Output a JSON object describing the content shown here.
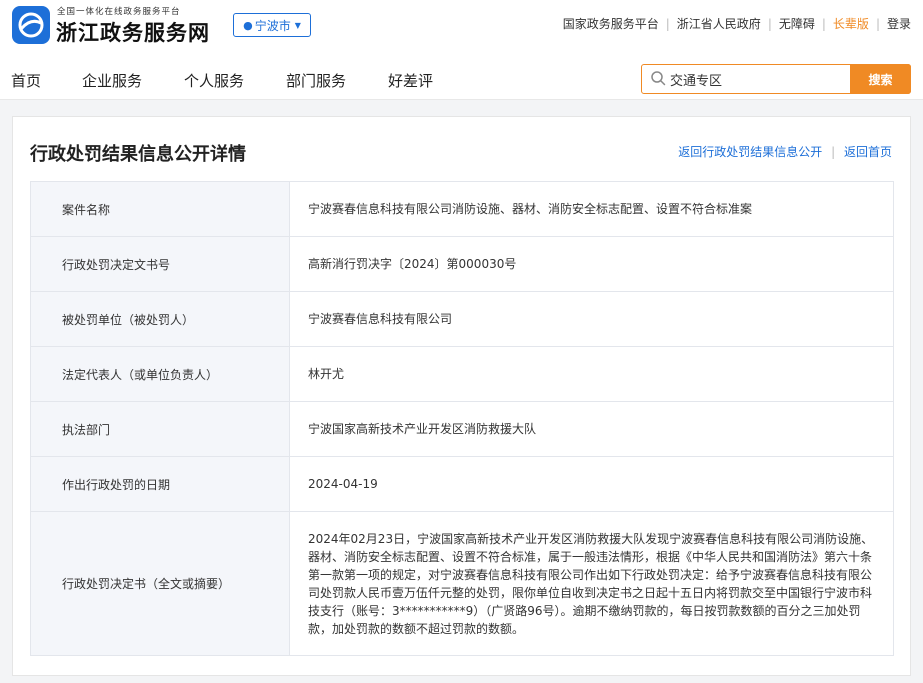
{
  "header": {
    "logo_subtitle": "全国一体化在线政务服务平台",
    "logo_title": "浙江政务服务网",
    "city": "宁波市",
    "links": [
      "国家政务服务平台",
      "浙江省人民政府",
      "无障碍",
      "长辈版",
      "登录"
    ]
  },
  "nav": {
    "items": [
      "首页",
      "企业服务",
      "个人服务",
      "部门服务",
      "好差评"
    ]
  },
  "search": {
    "value": "交通专区",
    "button": "搜索"
  },
  "page": {
    "title": "行政处罚结果信息公开详情",
    "back_link": "返回行政处罚结果信息公开",
    "home_link": "返回首页"
  },
  "details": [
    {
      "label": "案件名称",
      "value": "宁波赛春信息科技有限公司消防设施、器材、消防安全标志配置、设置不符合标准案"
    },
    {
      "label": "行政处罚决定文书号",
      "value": "高新消行罚决字〔2024〕第000030号"
    },
    {
      "label": "被处罚单位（被处罚人）",
      "value": "宁波赛春信息科技有限公司"
    },
    {
      "label": "法定代表人（或单位负责人）",
      "value": "林开尤"
    },
    {
      "label": "执法部门",
      "value": "宁波国家高新技术产业开发区消防救援大队"
    },
    {
      "label": "作出行政处罚的日期",
      "value": "2024-04-19"
    },
    {
      "label": "行政处罚决定书（全文或摘要）",
      "value": "2024年02月23日，宁波国家高新技术产业开发区消防救援大队发现宁波赛春信息科技有限公司消防设施、器材、消防安全标志配置、设置不符合标准，属于一般违法情形，根据《中华人民共和国消防法》第六十条第一款第一项的规定，对宁波赛春信息科技有限公司作出如下行政处罚决定：给予宁波赛春信息科技有限公司处罚款人民币壹万伍仟元整的处罚，限你单位自收到决定书之日起十五日内将罚款交至中国银行宁波市科技支行（账号：3***********9）（广贤路96号）。逾期不缴纳罚款的，每日按罚款数额的百分之三加处罚款，加处罚款的数额不超过罚款的数额。"
    }
  ],
  "colors": {
    "brand_blue": "#1d6fd8",
    "accent_orange": "#f08a24"
  }
}
